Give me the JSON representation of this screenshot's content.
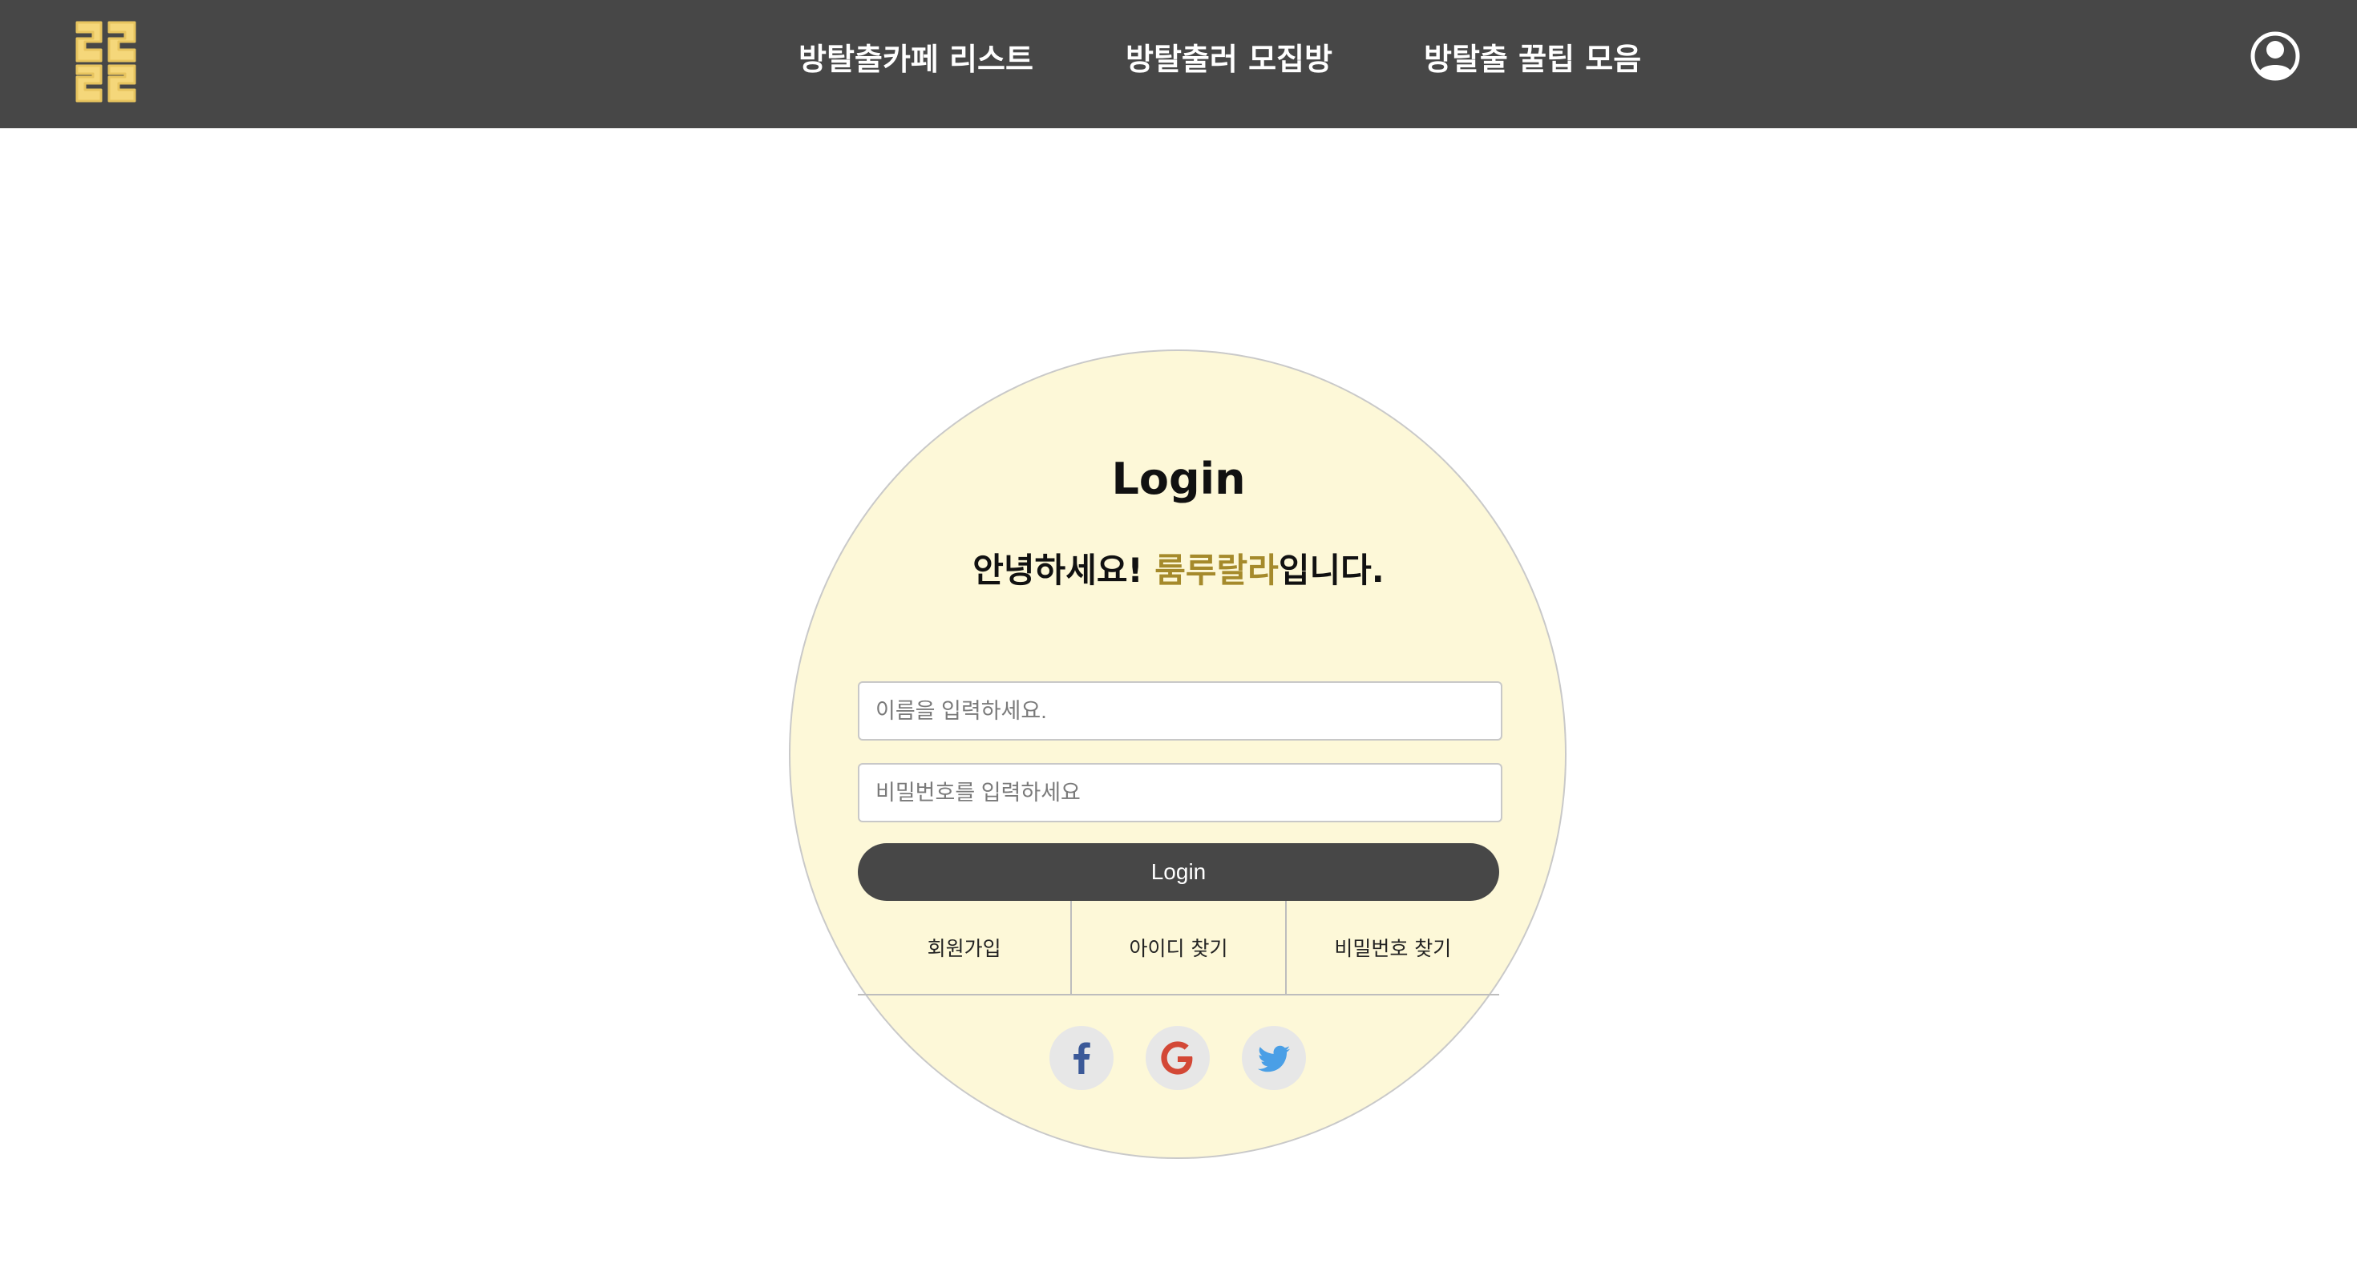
{
  "header": {
    "nav": [
      {
        "label": "방탈출카페 리스트"
      },
      {
        "label": "방탈출러 모집방"
      },
      {
        "label": "방탈출 꿀팁 모음"
      }
    ],
    "logo_icon": "rurulala-logo",
    "profile_icon": "user-circle-icon"
  },
  "login": {
    "title": "Login",
    "greeting_prefix": "안녕하세요! ",
    "greeting_brand": "룸루랄라",
    "greeting_suffix": "입니다.",
    "name_placeholder": "이름을 입력하세요.",
    "password_placeholder": "비밀번호를 입력하세요",
    "button_label": "Login",
    "links": [
      "회원가입",
      "아이디 찾기",
      "비밀번호 찾기"
    ],
    "social": [
      "facebook-icon",
      "google-icon",
      "twitter-icon"
    ]
  },
  "colors": {
    "header_bg": "#474747",
    "circle_bg": "#fdf8d8",
    "brand_text": "#a58a2b",
    "logo": "#f5d77a",
    "facebook": "#3b5998",
    "google": "#d34836",
    "twitter": "#4a9fe6"
  }
}
